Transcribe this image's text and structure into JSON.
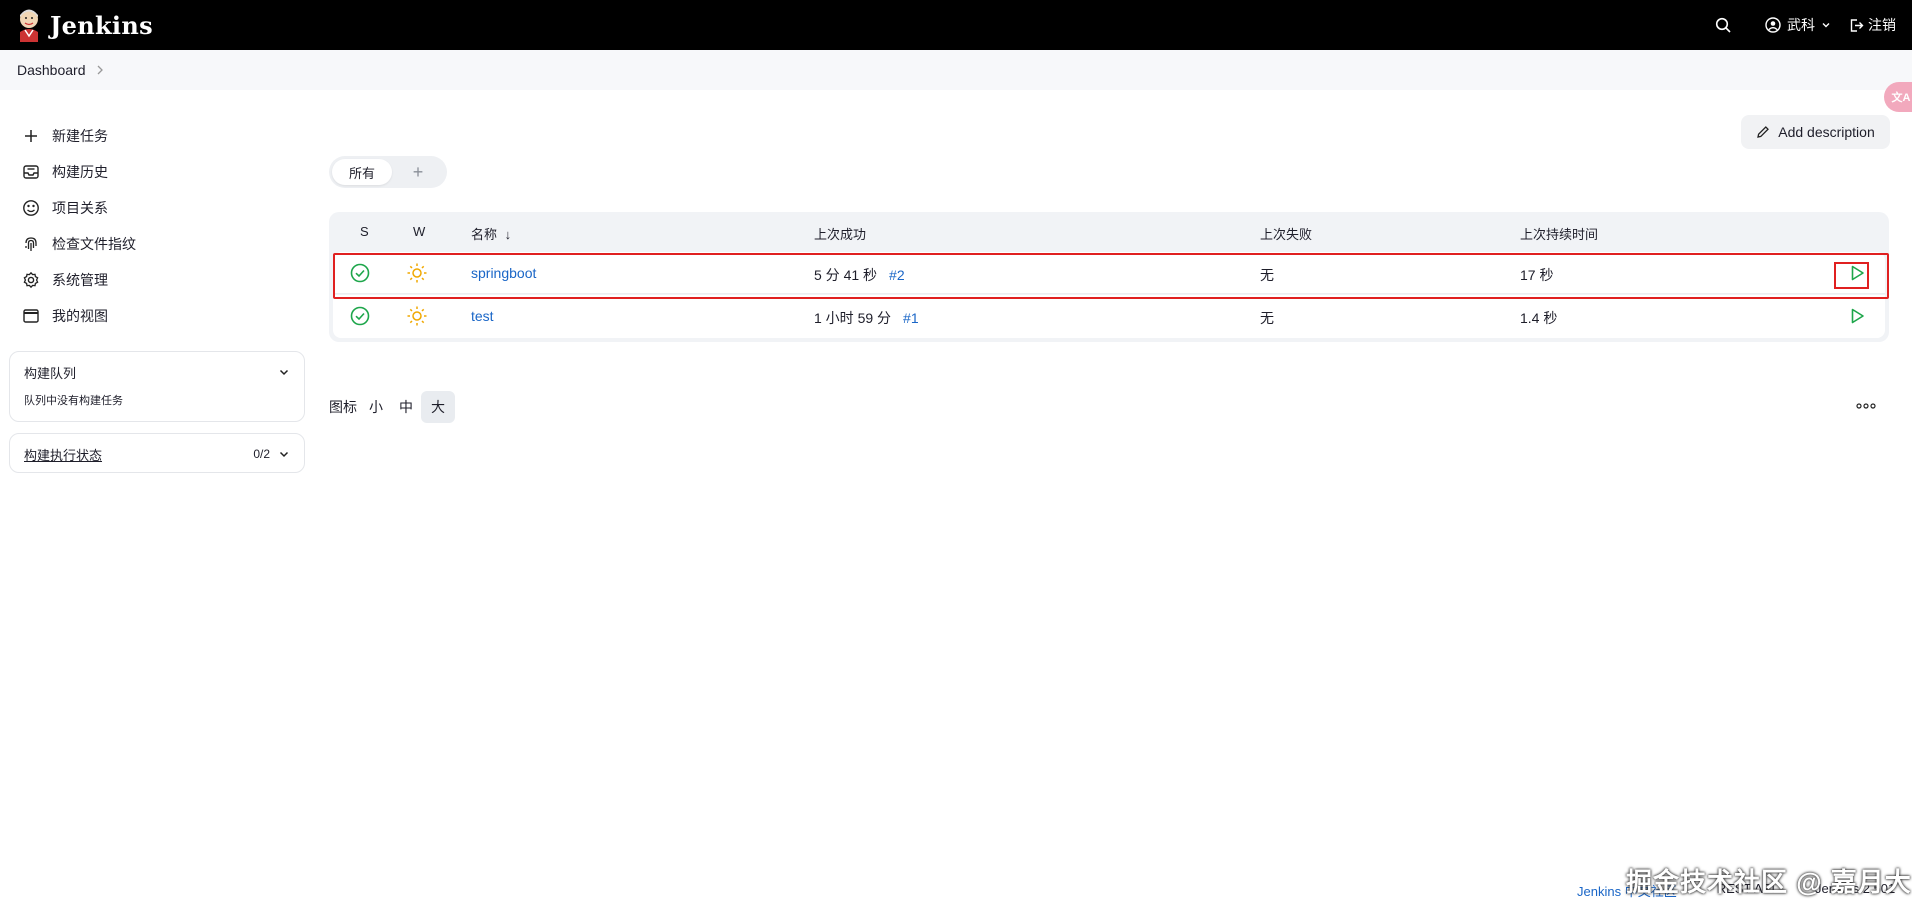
{
  "header": {
    "brand": "Jenkins",
    "user": "武科",
    "logout": "注销"
  },
  "breadcrumb": {
    "item": "Dashboard"
  },
  "sidebar": {
    "tasks": [
      {
        "label": "新建任务",
        "icon": "plus-icon"
      },
      {
        "label": "构建历史",
        "icon": "inbox-icon"
      },
      {
        "label": "项目关系",
        "icon": "relation-icon"
      },
      {
        "label": "检查文件指纹",
        "icon": "fingerprint-icon"
      },
      {
        "label": "系统管理",
        "icon": "gear-icon"
      },
      {
        "label": "我的视图",
        "icon": "window-icon"
      }
    ],
    "build_queue": {
      "title": "构建队列",
      "empty_text": "队列中没有构建任务"
    },
    "executors": {
      "title": "构建执行状态",
      "count": "0/2"
    }
  },
  "main": {
    "add_description": "Add description",
    "tabs": {
      "active": "所有",
      "add": "+"
    },
    "table": {
      "headers": {
        "s": "S",
        "w": "W",
        "name": "名称",
        "sort_arrow": "↓",
        "last_success": "上次成功",
        "last_failure": "上次失败",
        "last_duration": "上次持续时间"
      },
      "rows": [
        {
          "name": "springboot",
          "last_success": "5 分 41 秒",
          "build": "#2",
          "last_failure": "无",
          "duration": "17 秒",
          "status": "success",
          "weather": "sunny"
        },
        {
          "name": "test",
          "last_success": "1 小时 59 分",
          "build": "#1",
          "last_failure": "无",
          "duration": "1.4 秒",
          "status": "success",
          "weather": "sunny"
        }
      ]
    },
    "icon_size": {
      "label": "图标",
      "small": "小",
      "medium": "中",
      "large": "大",
      "selected": "大"
    }
  },
  "footer": {
    "community": "Jenkins 中文社区",
    "rest_api": "REST API",
    "version": "Jenkins 2.501"
  },
  "watermark": "掘金技术社区 @ 嘉月大",
  "colors": {
    "header_bg": "#000000",
    "link": "#1a66c7",
    "success": "#1ea64b",
    "weather": "#f0a800",
    "highlight": "#e02020"
  }
}
